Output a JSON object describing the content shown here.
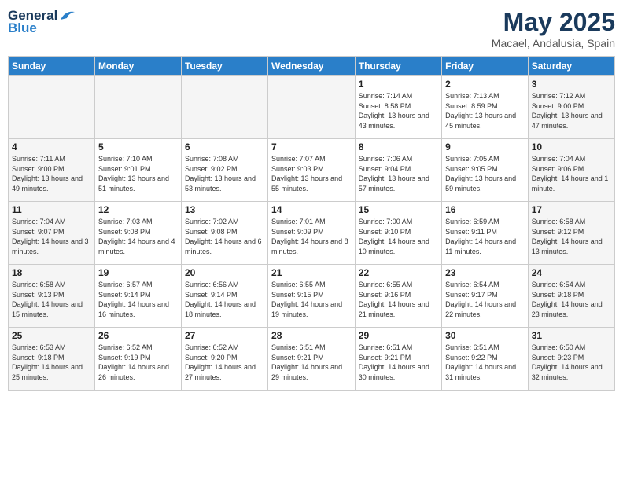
{
  "header": {
    "logo_general": "General",
    "logo_blue": "Blue",
    "month_year": "May 2025",
    "location": "Macael, Andalusia, Spain"
  },
  "weekdays": [
    "Sunday",
    "Monday",
    "Tuesday",
    "Wednesday",
    "Thursday",
    "Friday",
    "Saturday"
  ],
  "weeks": [
    [
      {
        "day": "",
        "empty": true
      },
      {
        "day": "",
        "empty": true
      },
      {
        "day": "",
        "empty": true
      },
      {
        "day": "",
        "empty": true
      },
      {
        "day": "1",
        "sunrise": "7:14 AM",
        "sunset": "8:58 PM",
        "daylight": "13 hours and 43 minutes."
      },
      {
        "day": "2",
        "sunrise": "7:13 AM",
        "sunset": "8:59 PM",
        "daylight": "13 hours and 45 minutes."
      },
      {
        "day": "3",
        "sunrise": "7:12 AM",
        "sunset": "9:00 PM",
        "daylight": "13 hours and 47 minutes."
      }
    ],
    [
      {
        "day": "4",
        "sunrise": "7:11 AM",
        "sunset": "9:00 PM",
        "daylight": "13 hours and 49 minutes."
      },
      {
        "day": "5",
        "sunrise": "7:10 AM",
        "sunset": "9:01 PM",
        "daylight": "13 hours and 51 minutes."
      },
      {
        "day": "6",
        "sunrise": "7:08 AM",
        "sunset": "9:02 PM",
        "daylight": "13 hours and 53 minutes."
      },
      {
        "day": "7",
        "sunrise": "7:07 AM",
        "sunset": "9:03 PM",
        "daylight": "13 hours and 55 minutes."
      },
      {
        "day": "8",
        "sunrise": "7:06 AM",
        "sunset": "9:04 PM",
        "daylight": "13 hours and 57 minutes."
      },
      {
        "day": "9",
        "sunrise": "7:05 AM",
        "sunset": "9:05 PM",
        "daylight": "13 hours and 59 minutes."
      },
      {
        "day": "10",
        "sunrise": "7:04 AM",
        "sunset": "9:06 PM",
        "daylight": "14 hours and 1 minute."
      }
    ],
    [
      {
        "day": "11",
        "sunrise": "7:04 AM",
        "sunset": "9:07 PM",
        "daylight": "14 hours and 3 minutes."
      },
      {
        "day": "12",
        "sunrise": "7:03 AM",
        "sunset": "9:08 PM",
        "daylight": "14 hours and 4 minutes."
      },
      {
        "day": "13",
        "sunrise": "7:02 AM",
        "sunset": "9:08 PM",
        "daylight": "14 hours and 6 minutes."
      },
      {
        "day": "14",
        "sunrise": "7:01 AM",
        "sunset": "9:09 PM",
        "daylight": "14 hours and 8 minutes."
      },
      {
        "day": "15",
        "sunrise": "7:00 AM",
        "sunset": "9:10 PM",
        "daylight": "14 hours and 10 minutes."
      },
      {
        "day": "16",
        "sunrise": "6:59 AM",
        "sunset": "9:11 PM",
        "daylight": "14 hours and 11 minutes."
      },
      {
        "day": "17",
        "sunrise": "6:58 AM",
        "sunset": "9:12 PM",
        "daylight": "14 hours and 13 minutes."
      }
    ],
    [
      {
        "day": "18",
        "sunrise": "6:58 AM",
        "sunset": "9:13 PM",
        "daylight": "14 hours and 15 minutes."
      },
      {
        "day": "19",
        "sunrise": "6:57 AM",
        "sunset": "9:14 PM",
        "daylight": "14 hours and 16 minutes."
      },
      {
        "day": "20",
        "sunrise": "6:56 AM",
        "sunset": "9:14 PM",
        "daylight": "14 hours and 18 minutes."
      },
      {
        "day": "21",
        "sunrise": "6:55 AM",
        "sunset": "9:15 PM",
        "daylight": "14 hours and 19 minutes."
      },
      {
        "day": "22",
        "sunrise": "6:55 AM",
        "sunset": "9:16 PM",
        "daylight": "14 hours and 21 minutes."
      },
      {
        "day": "23",
        "sunrise": "6:54 AM",
        "sunset": "9:17 PM",
        "daylight": "14 hours and 22 minutes."
      },
      {
        "day": "24",
        "sunrise": "6:54 AM",
        "sunset": "9:18 PM",
        "daylight": "14 hours and 23 minutes."
      }
    ],
    [
      {
        "day": "25",
        "sunrise": "6:53 AM",
        "sunset": "9:18 PM",
        "daylight": "14 hours and 25 minutes."
      },
      {
        "day": "26",
        "sunrise": "6:52 AM",
        "sunset": "9:19 PM",
        "daylight": "14 hours and 26 minutes."
      },
      {
        "day": "27",
        "sunrise": "6:52 AM",
        "sunset": "9:20 PM",
        "daylight": "14 hours and 27 minutes."
      },
      {
        "day": "28",
        "sunrise": "6:51 AM",
        "sunset": "9:21 PM",
        "daylight": "14 hours and 29 minutes."
      },
      {
        "day": "29",
        "sunrise": "6:51 AM",
        "sunset": "9:21 PM",
        "daylight": "14 hours and 30 minutes."
      },
      {
        "day": "30",
        "sunrise": "6:51 AM",
        "sunset": "9:22 PM",
        "daylight": "14 hours and 31 minutes."
      },
      {
        "day": "31",
        "sunrise": "6:50 AM",
        "sunset": "9:23 PM",
        "daylight": "14 hours and 32 minutes."
      }
    ]
  ],
  "labels": {
    "sunrise_prefix": "Sunrise: ",
    "sunset_prefix": "Sunset: ",
    "daylight_prefix": "Daylight: "
  }
}
